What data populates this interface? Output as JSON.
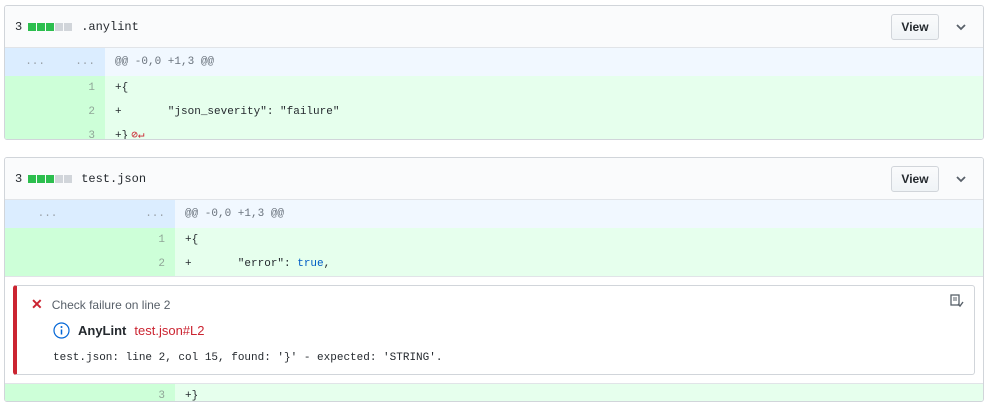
{
  "files": [
    {
      "count": "3",
      "diffstat": [
        "add",
        "add",
        "add",
        "neutral",
        "neutral"
      ],
      "name": ".anylint",
      "view_label": "View",
      "hunk": "@@ -0,0 +1,3 @@",
      "hunk_old": "...",
      "hunk_new": "...",
      "lines": [
        {
          "num": "1",
          "text": "+{"
        },
        {
          "num": "2",
          "text": "+       \"json_severity\": \"failure\""
        },
        {
          "num": "3",
          "text": "+}"
        }
      ]
    },
    {
      "count": "3",
      "diffstat": [
        "add",
        "add",
        "add",
        "neutral",
        "neutral"
      ],
      "name": "test.json",
      "view_label": "View",
      "hunk": "@@ -0,0 +1,3 @@",
      "hunk_old": "...",
      "hunk_new": "...",
      "lines": [
        {
          "num": "1",
          "text": "+{"
        },
        {
          "num": "2",
          "text_prefix": "+       \"error\": ",
          "text_kw": "true",
          "text_suffix": ","
        },
        {
          "num": "3",
          "text": "+}"
        }
      ]
    }
  ],
  "annotation": {
    "title": "Check failure on line 2",
    "check_name": "AnyLint",
    "link": "test.json#L2",
    "message": "test.json: line 2, col 15, found: '}' - expected: 'STRING'."
  },
  "colors": {
    "added_bg": "#e6ffed",
    "added_num_bg": "#cdffd8",
    "hunk_bg": "#f1f8ff",
    "failure": "#cb2431",
    "diffstat_add": "#2cbe4e"
  }
}
